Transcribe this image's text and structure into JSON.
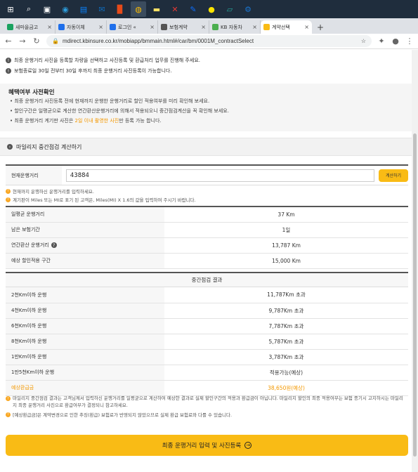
{
  "taskbar": {
    "items": [
      {
        "icon": "windows-logo-icon",
        "glyph": "⊞",
        "color": "#ffffff"
      },
      {
        "icon": "search-icon",
        "glyph": "⌕",
        "color": "#ffffff"
      },
      {
        "icon": "task-view-icon",
        "glyph": "▣",
        "color": "#ffffff"
      },
      {
        "icon": "edge-icon",
        "glyph": "◉",
        "color": "#2d9cdb"
      },
      {
        "icon": "store-icon",
        "glyph": "▤",
        "color": "#0a84ff"
      },
      {
        "icon": "mail-icon",
        "glyph": "✉",
        "color": "#0f6cbd"
      },
      {
        "icon": "office-icon",
        "glyph": "▉",
        "color": "#e64a19"
      },
      {
        "icon": "chrome-icon",
        "glyph": "◍",
        "color": "#fbbc05"
      },
      {
        "icon": "sticky-notes-icon",
        "glyph": "▬",
        "color": "#ffe266"
      },
      {
        "icon": "app-x-icon",
        "glyph": "✕",
        "color": "#e53935"
      },
      {
        "icon": "pen-app-icon",
        "glyph": "✎",
        "color": "#0d6efd"
      },
      {
        "icon": "kakaotalk-icon",
        "glyph": "●",
        "color": "#fee500"
      },
      {
        "icon": "notebook-icon",
        "glyph": "▱",
        "color": "#26a69a"
      },
      {
        "icon": "settings-app-icon",
        "glyph": "⚙",
        "color": "#1976d2"
      }
    ]
  },
  "browser": {
    "tabs": [
      {
        "title": "새마을금고",
        "fav_color": "#1aa260",
        "active": false
      },
      {
        "title": "자동이체",
        "fav_color": "#1f6feb",
        "active": false
      },
      {
        "title": "로그인 «",
        "fav_color": "#1f6feb",
        "active": false
      },
      {
        "title": "보험계약",
        "fav_color": "#555555",
        "active": false
      },
      {
        "title": "KB 자동차",
        "fav_color": "#4caf50",
        "active": false
      },
      {
        "title": "계약선택",
        "fav_color": "#f9bb15",
        "active": true
      }
    ],
    "new_tab_label": "+",
    "url": "mdirect.kbinsure.co.kr/mobiapp/bmmain.html#/car/bm/0001M_contractSelect"
  },
  "page": {
    "notices_top": [
      "최종 운행거리 사진을 등록할 차량을 선택하고 사진등록 및 환급처리 업무를 진행해 주세요.",
      "보험종료일 30일 전부터 30일 후까지 최종 운행거리 사진등록이 가능합니다."
    ],
    "precheck": {
      "title": "혜택여부 사전확인",
      "items": [
        "• 최종 운행거리 사진등록 전에 현재까지 운행한 운행거리로 할인 적용여부를 미리 확인해 보세요.",
        "• 할인구간은 일평균으로 계산한 연간환산운행거리에 의해서 적용되오니 중간점검계산을 꼭 확인해 보세요."
      ],
      "last_item_prefix": "• 최종 운행거리 계기판 사진은 ",
      "last_item_highlight": "2일 이내 촬영한 사진",
      "last_item_suffix": "만 등록 가능 합니다."
    },
    "section_title": "마일리지 중간점검 계산하기",
    "input": {
      "label": "현재운행거리",
      "value": "43884",
      "button": "계산하기"
    },
    "input_notes": [
      "현재까지 운행하신 운행거리를 입력하세요.",
      "계기판이 Miles 또는 MI로 표기 된 고객은, Miles(MI) X 1.6의 값을 입력하여 주시기 바랍니다."
    ],
    "summary_rows": [
      {
        "label": "일평균 운행거리",
        "value": "37 Km"
      },
      {
        "label": "남은 보험기간",
        "value": "1일"
      },
      {
        "label": "연간환산 운행거리",
        "value": "13,787 Km",
        "help": true
      },
      {
        "label": "예상 할인적용 구간",
        "value": "15,000 Km"
      }
    ],
    "result_title": "중간점검 결과",
    "result_rows": [
      {
        "label": "2천Km이하 운행",
        "value": "11,787Km 초과"
      },
      {
        "label": "4천Km이하 운행",
        "value": "9,787Km 초과"
      },
      {
        "label": "6천Km이하 운행",
        "value": "7,787Km 초과"
      },
      {
        "label": "8천Km이하 운행",
        "value": "5,787Km 초과"
      },
      {
        "label": "1만Km이하 운행",
        "value": "3,787Km 초과"
      },
      {
        "label": "1만5천Km이하 운행",
        "value": "적용가능(예상)"
      },
      {
        "label": "예상환급금",
        "value": "38,650원(예상)",
        "highlight": true
      }
    ],
    "bottom_notes": [
      "마일리지 중간점검 결과는 고객님께서 입력하신 운행거리를 일평균으로 계산하여 예상한 결과로 실제 할인구간의 적용과 환급금이 아닙니다. 마일리지 할인의 최종 적용여부는 보험 종기시 고지하시는 마일리지 최종 운행거리 사진으로 환급여부가 결정되니 참고하세요.",
      "[예상환급금]은 계약변경으로 인한 추징(환급) 보험료가 반영되지 않았으므로 실제 환급 보험료와 다를 수 있습니다."
    ],
    "cta_label": "최종 운행거리 입력 및 사진등록"
  },
  "colors": {
    "accent": "#f9bb15",
    "highlight_text": "#f39800"
  }
}
